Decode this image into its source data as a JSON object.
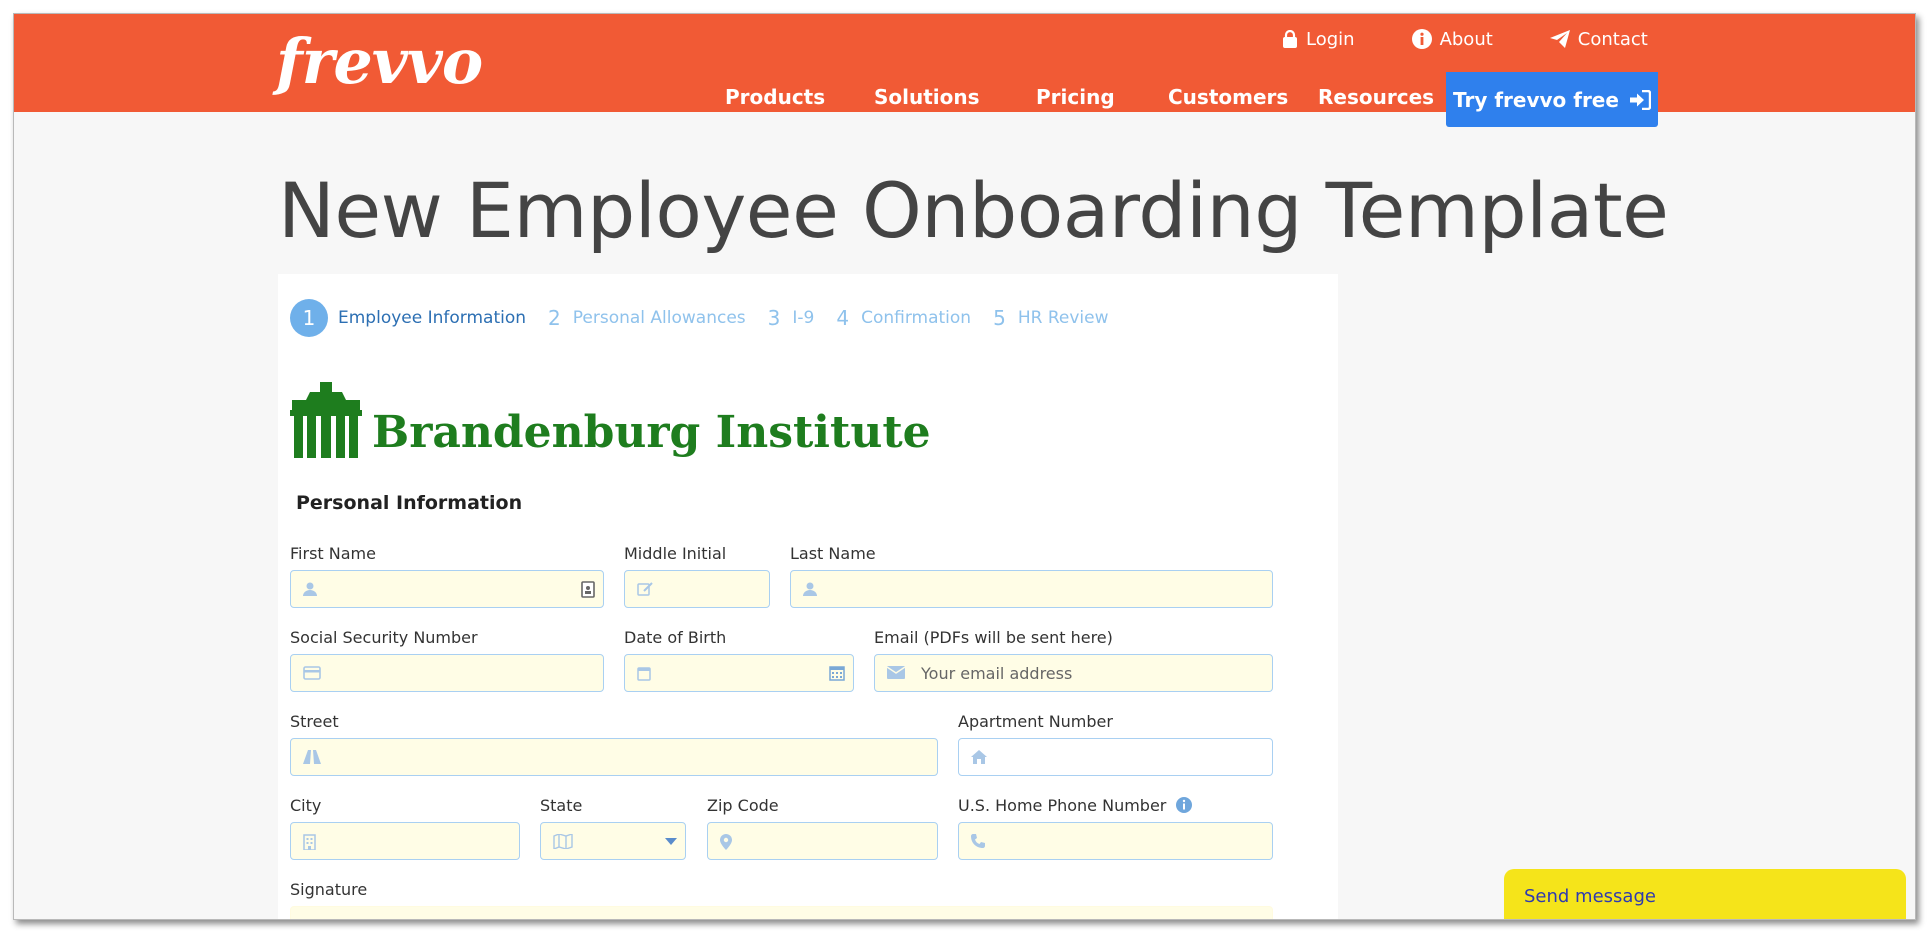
{
  "header": {
    "logo": "frevvo",
    "top_links": [
      {
        "label": "Login",
        "icon": "lock-icon"
      },
      {
        "label": "About",
        "icon": "info-icon"
      },
      {
        "label": "Contact",
        "icon": "paper-plane-icon"
      }
    ],
    "nav": [
      "Products",
      "Solutions",
      "Pricing",
      "Customers",
      "Resources"
    ],
    "cta": "Try frevvo free",
    "colors": {
      "bar": "#f15a35",
      "cta": "#2f80ed"
    }
  },
  "page": {
    "title": "New Employee Onboarding Template"
  },
  "wizard": {
    "steps": [
      {
        "num": "1",
        "label": "Employee Information",
        "active": true
      },
      {
        "num": "2",
        "label": "Personal Allowances"
      },
      {
        "num": "3",
        "label": "I-9"
      },
      {
        "num": "4",
        "label": "Confirmation"
      },
      {
        "num": "5",
        "label": "HR Review"
      }
    ]
  },
  "brand": {
    "name": "Brandenburg Institute",
    "color": "#1e7d1e"
  },
  "form": {
    "section": "Personal Information",
    "fields": {
      "first_name": {
        "label": "First Name",
        "value": ""
      },
      "middle_initial": {
        "label": "Middle Initial",
        "value": ""
      },
      "last_name": {
        "label": "Last Name",
        "value": ""
      },
      "ssn": {
        "label": "Social Security Number",
        "value": ""
      },
      "dob": {
        "label": "Date of Birth",
        "value": ""
      },
      "email": {
        "label": "Email (PDFs will be sent here)",
        "placeholder": "Your email address",
        "value": ""
      },
      "street": {
        "label": "Street",
        "value": ""
      },
      "apartment": {
        "label": "Apartment Number",
        "value": ""
      },
      "city": {
        "label": "City",
        "value": ""
      },
      "state": {
        "label": "State",
        "value": ""
      },
      "zip": {
        "label": "Zip Code",
        "value": ""
      },
      "phone": {
        "label": "U.S. Home Phone Number",
        "value": ""
      },
      "signature": {
        "label": "Signature",
        "value": ""
      }
    }
  },
  "chat": {
    "label": "Send message"
  }
}
